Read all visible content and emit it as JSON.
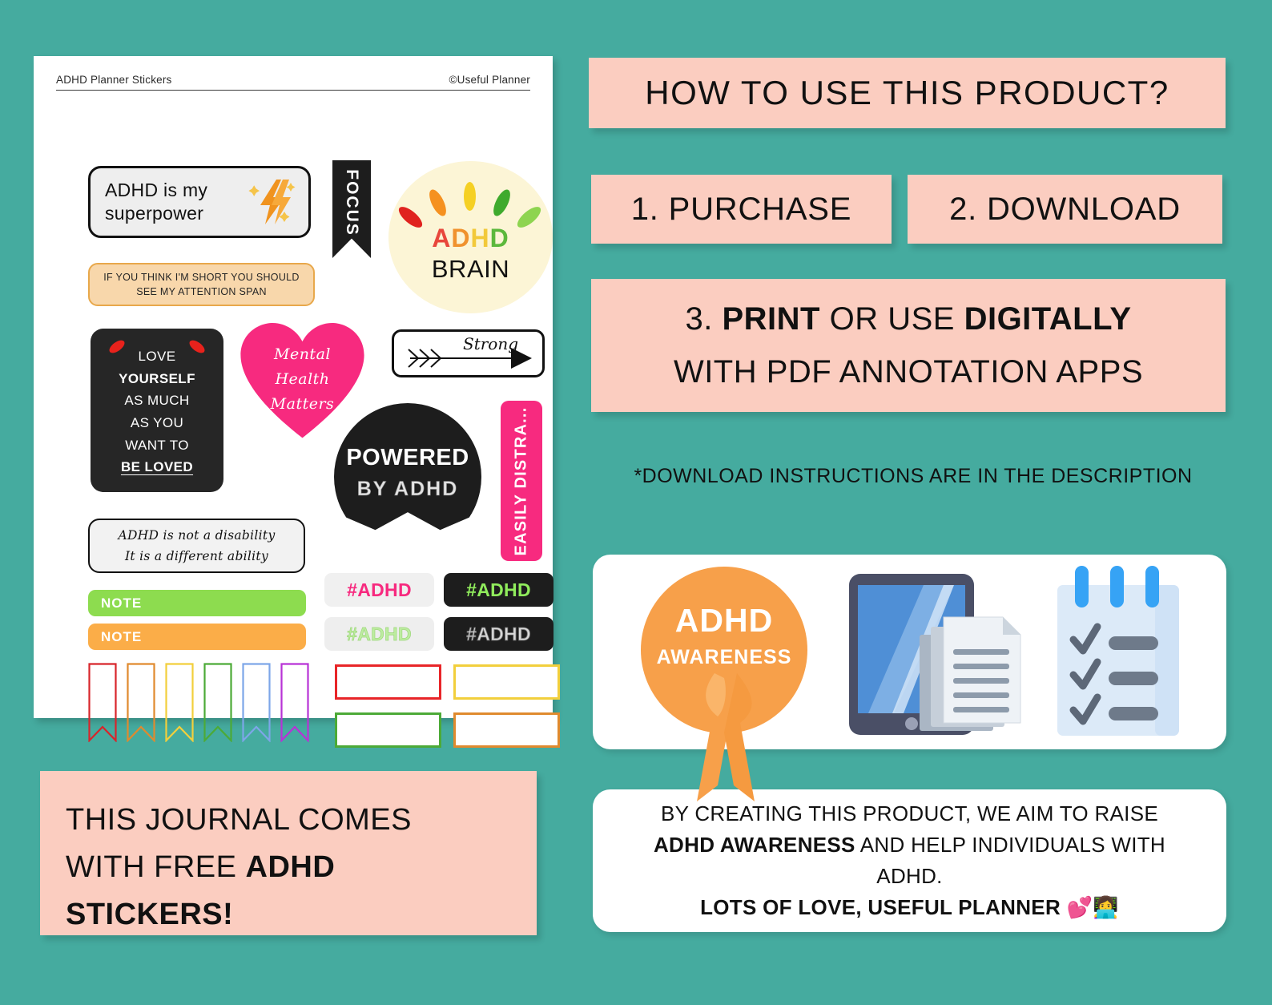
{
  "colors": {
    "background_teal": "#45AB9F",
    "pink_panel": "#FBCDC0",
    "hot_pink": "#F72A7F",
    "orange_accent": "#F7A04A",
    "lime_green": "#8DDC4F",
    "note_orange": "#FBAD48"
  },
  "sheet": {
    "header_left": "ADHD Planner Stickers",
    "header_right": "©Useful Planner",
    "stickers": {
      "superpower": {
        "line1": "ADHD is my",
        "line2": "superpower",
        "icon": "lightning-bolt-icon"
      },
      "focus_ribbon": {
        "label": "FOCUS"
      },
      "brain": {
        "top": "ADHD",
        "bottom": "BRAIN",
        "ray_colors": [
          "#e0231f",
          "#f59120",
          "#f5d024",
          "#3faa2d",
          "#8ed450"
        ],
        "letter_colors": [
          "#e8473c",
          "#f0922e",
          "#f2c93a",
          "#5cb83c"
        ]
      },
      "attention": {
        "line1": "IF YOU THINK I'M SHORT YOU SHOULD",
        "line2": "SEE MY ATTENTION SPAN"
      },
      "love": {
        "lines": [
          "LOVE",
          "YOURSELF",
          "AS MUCH",
          "AS YOU",
          "WANT TO",
          "BE LOVED"
        ]
      },
      "heart": {
        "lines": [
          "Mental",
          "Health",
          "Matters"
        ],
        "color": "#f72a7f"
      },
      "strong": {
        "label": "Strong",
        "icon": "arrow-right-icon"
      },
      "powered": {
        "line1": "POWERED",
        "line2": "BY ADHD"
      },
      "distracted": {
        "label": "EASILY DISTRA..."
      },
      "disability": {
        "line1": "ADHD is not a disability",
        "line2": "It is a different ability"
      },
      "notes": [
        {
          "label": "NOTE",
          "color": "#8ddc4f"
        },
        {
          "label": "NOTE",
          "color": "#fbad48"
        }
      ],
      "tags": [
        {
          "label": "#ADHD",
          "style": "pink-on-light"
        },
        {
          "label": "#ADHD",
          "style": "green-on-black"
        },
        {
          "label": "#ADHD",
          "style": "pale-green-outline"
        },
        {
          "label": "#ADHD",
          "style": "silver-striped-on-black"
        }
      ],
      "flag_colors": [
        "#d8252b",
        "#e08a2e",
        "#f2cf3c",
        "#4caa37",
        "#7da6e8",
        "#b832d6"
      ],
      "box_colors": [
        "#e82528",
        "#f2cf3c",
        "#4caa37",
        "#e08a2e"
      ]
    }
  },
  "right": {
    "title": "HOW TO USE THIS PRODUCT?",
    "step1": "1. PURCHASE",
    "step2": "2. DOWNLOAD",
    "step3": {
      "line1_pre": "3. ",
      "line1_b1": "PRINT",
      "line1_mid": " OR USE ",
      "line1_b2": "DIGITALLY",
      "line2": "WITH PDF ANNOTATION APPS"
    },
    "footnote": "*DOWNLOAD INSTRUCTIONS ARE IN THE DESCRIPTION",
    "awareness": {
      "line1": "ADHD",
      "line2": "AWARENESS"
    },
    "illustrations": [
      "ribbon-icon",
      "tablet-icon",
      "documents-icon",
      "checklist-icon"
    ],
    "message": {
      "line1": "BY CREATING THIS PRODUCT, WE AIM TO RAISE",
      "line2_b": "ADHD AWARENESS",
      "line2_rest": " AND HELP INDIVIDUALS WITH",
      "line3": "ADHD.",
      "line4": "LOTS OF LOVE, USEFUL PLANNER",
      "emoji": "💕👩‍💻"
    }
  },
  "bottom_left": {
    "line1": "THIS JOURNAL COMES",
    "line2_pre": "WITH FREE ",
    "line2_b": "ADHD",
    "line3_b": "STICKERS",
    "line3_post": "!"
  }
}
